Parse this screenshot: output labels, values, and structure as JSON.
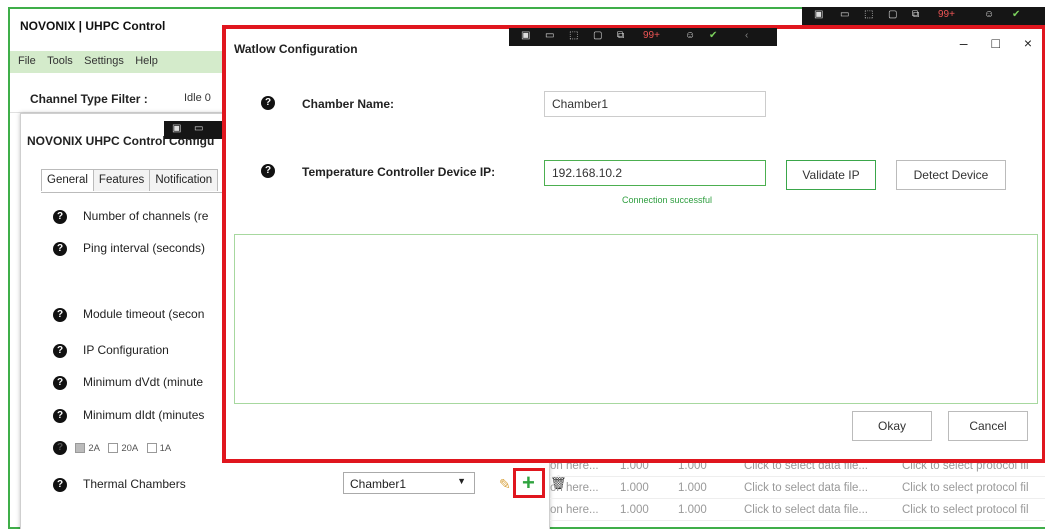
{
  "app": {
    "title": "NOVONIX | UHPC Control",
    "menu": [
      "File",
      "Tools",
      "Settings",
      "Help"
    ],
    "filter_label": "Channel Type Filter :",
    "filter_value": "Idle 0"
  },
  "config": {
    "title": "NOVONIX UHPC Control Configu",
    "tabs": [
      "General",
      "Features",
      "Notification"
    ],
    "rows": {
      "channels": "Number of channels (re",
      "ping": "Ping interval (seconds)",
      "timeout": "Module timeout (secon",
      "ip": "IP Configuration",
      "dvdt": "Minimum dVdt (minute",
      "didt": "Minimum dIdt (minutes",
      "thermal": "Thermal Chambers"
    },
    "currents": [
      "2A",
      "20A",
      "1A"
    ],
    "chamber_select": "Chamber1"
  },
  "grid_rows": [
    {
      "a": "on here...",
      "b": "1.000",
      "c": "1.000",
      "d": "Click to select data file...",
      "e": "Click to select protocol fil"
    },
    {
      "a": "on here...",
      "b": "1.000",
      "c": "1.000",
      "d": "Click to select data file...",
      "e": "Click to select protocol fil"
    },
    {
      "a": "on here...",
      "b": "1.000",
      "c": "1.000",
      "d": "Click to select data file...",
      "e": "Click to select protocol fil"
    }
  ],
  "taskbar": {
    "badge": "99+"
  },
  "watlow": {
    "title": "Watlow Configuration",
    "chamber_label": "Chamber Name:",
    "chamber_value": "Chamber1",
    "ip_label": "Temperature Controller Device IP:",
    "ip_value": "192.168.10.2",
    "status": "Connection successful",
    "validate_btn": "Validate IP",
    "detect_btn": "Detect Device",
    "okay_btn": "Okay",
    "cancel_btn": "Cancel",
    "min": "–",
    "max": "□",
    "close": "×"
  }
}
